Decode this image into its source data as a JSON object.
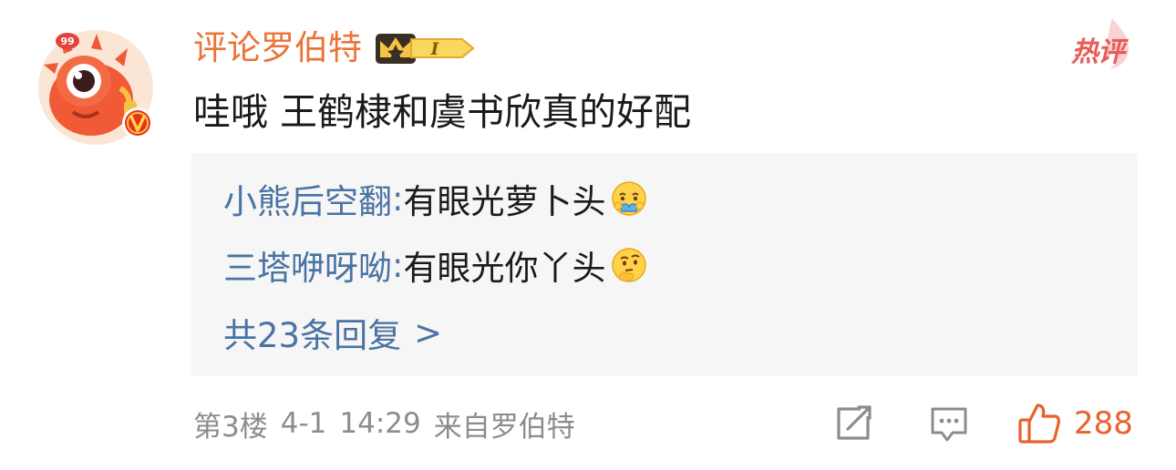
{
  "comment": {
    "avatar_badge_count": "99",
    "username": "评论罗伯特",
    "level_badge": "I",
    "hot_label": "热评",
    "content": "哇哦 王鹤棣和虞书欣真的好配",
    "replies": [
      {
        "user": "小熊后空翻",
        "separator": ":",
        "text": " 有眼光萝卜头",
        "emoji": "hug-emoji"
      },
      {
        "user": "三塔咿呀呦",
        "separator": ":",
        "text": " 有眼光你丫头",
        "emoji": "thinking-emoji"
      }
    ],
    "more_replies": {
      "label": "共23条回复",
      "arrow": ">"
    },
    "meta": {
      "floor": "第3楼",
      "date": "4-1",
      "time": "14:29",
      "source": "来自罗伯特"
    },
    "actions": {
      "share_icon": "share-icon",
      "comment_icon": "comment-icon",
      "like_icon": "thumbs-up-icon",
      "like_count": "288"
    },
    "colors": {
      "username": "#ec7336",
      "reply_user": "#4a73a3",
      "hot_label": "#e95b5b",
      "like": "#e8622c",
      "reply_bg": "#f6f6f6",
      "meta_text": "#8c8c8c"
    }
  }
}
